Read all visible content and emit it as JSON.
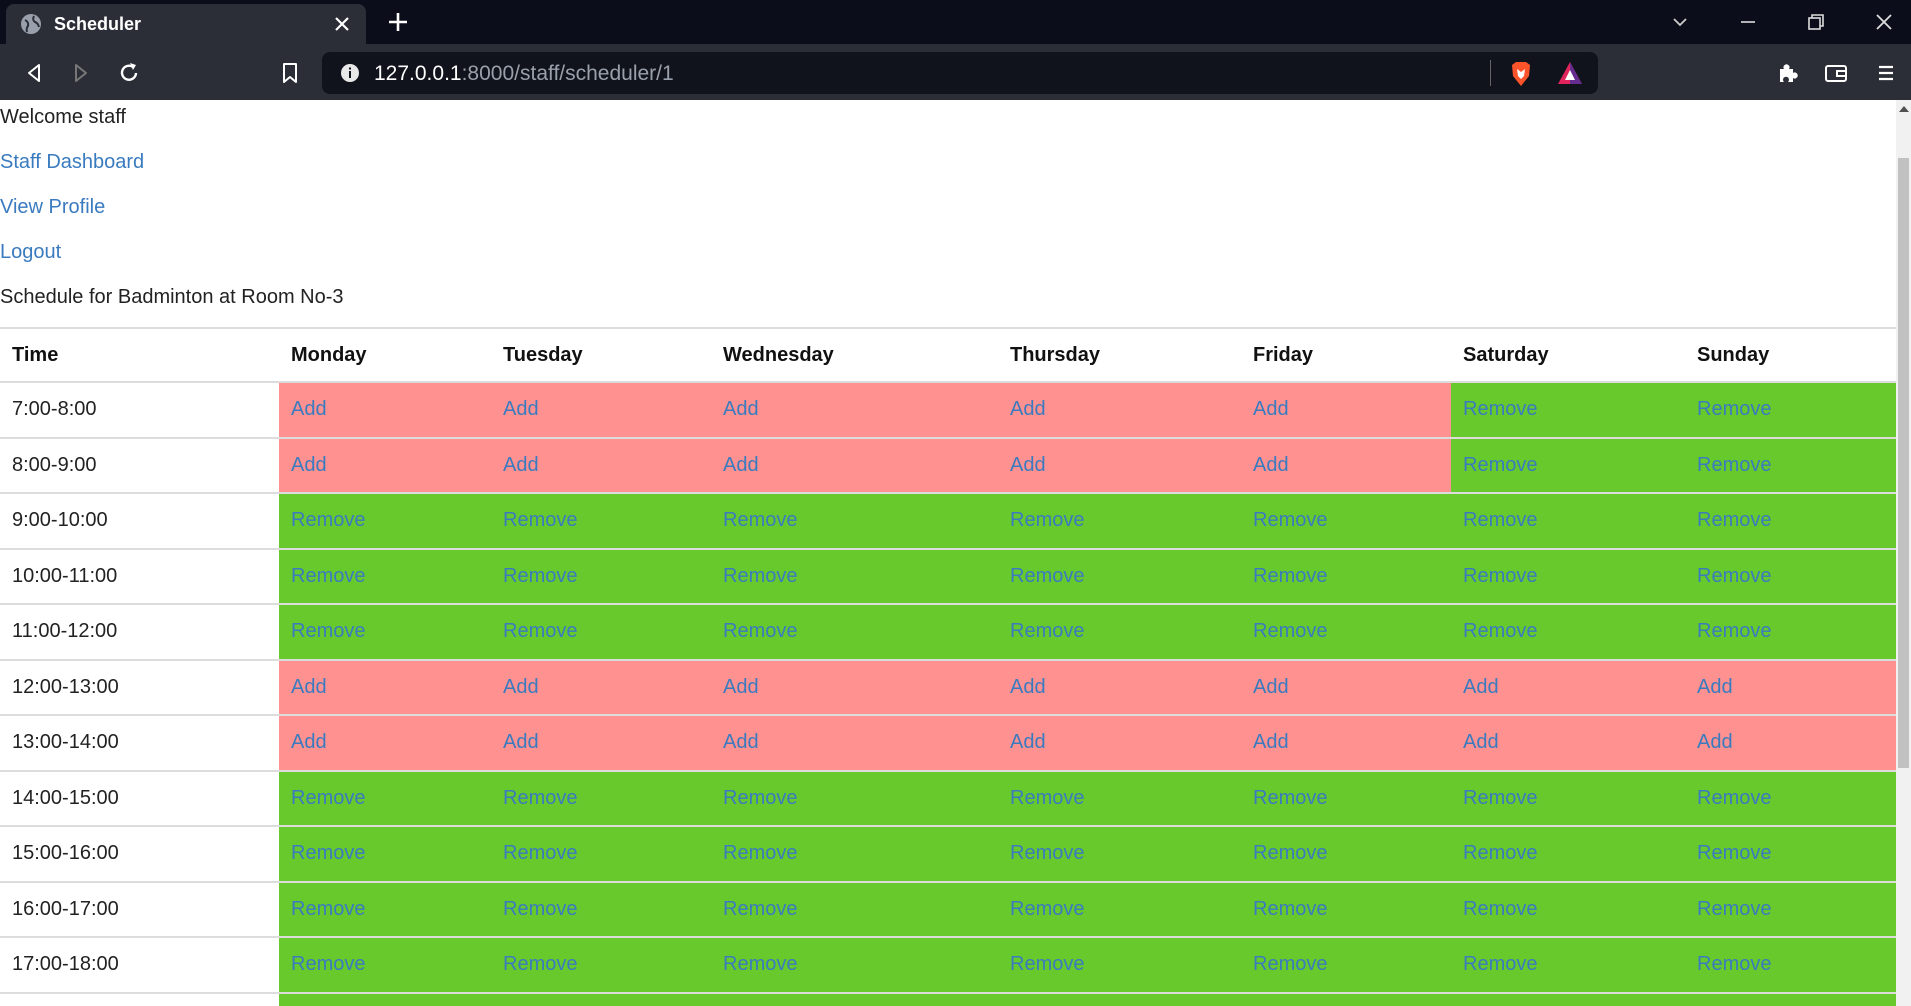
{
  "browser": {
    "tab_title": "Scheduler",
    "url_host": "127.0.0.1",
    "url_rest": ":8000/staff/scheduler/1"
  },
  "page": {
    "welcome": "Welcome staff",
    "links": {
      "dashboard": "Staff Dashboard",
      "profile": "View Profile",
      "logout": "Logout"
    },
    "schedule_title": "Schedule for Badminton at Room No-3"
  },
  "colors": {
    "add_cell": "#ff9191",
    "remove_cell": "#68c92c",
    "link": "#3a7bbf"
  },
  "schedule": {
    "headers": [
      "Time",
      "Monday",
      "Tuesday",
      "Wednesday",
      "Thursday",
      "Friday",
      "Saturday",
      "Sunday"
    ],
    "rows": [
      {
        "time": "7:00-8:00",
        "cells": [
          "Add",
          "Add",
          "Add",
          "Add",
          "Add",
          "Remove",
          "Remove"
        ]
      },
      {
        "time": "8:00-9:00",
        "cells": [
          "Add",
          "Add",
          "Add",
          "Add",
          "Add",
          "Remove",
          "Remove"
        ]
      },
      {
        "time": "9:00-10:00",
        "cells": [
          "Remove",
          "Remove",
          "Remove",
          "Remove",
          "Remove",
          "Remove",
          "Remove"
        ]
      },
      {
        "time": "10:00-11:00",
        "cells": [
          "Remove",
          "Remove",
          "Remove",
          "Remove",
          "Remove",
          "Remove",
          "Remove"
        ]
      },
      {
        "time": "11:00-12:00",
        "cells": [
          "Remove",
          "Remove",
          "Remove",
          "Remove",
          "Remove",
          "Remove",
          "Remove"
        ]
      },
      {
        "time": "12:00-13:00",
        "cells": [
          "Add",
          "Add",
          "Add",
          "Add",
          "Add",
          "Add",
          "Add"
        ]
      },
      {
        "time": "13:00-14:00",
        "cells": [
          "Add",
          "Add",
          "Add",
          "Add",
          "Add",
          "Add",
          "Add"
        ]
      },
      {
        "time": "14:00-15:00",
        "cells": [
          "Remove",
          "Remove",
          "Remove",
          "Remove",
          "Remove",
          "Remove",
          "Remove"
        ]
      },
      {
        "time": "15:00-16:00",
        "cells": [
          "Remove",
          "Remove",
          "Remove",
          "Remove",
          "Remove",
          "Remove",
          "Remove"
        ]
      },
      {
        "time": "16:00-17:00",
        "cells": [
          "Remove",
          "Remove",
          "Remove",
          "Remove",
          "Remove",
          "Remove",
          "Remove"
        ]
      },
      {
        "time": "17:00-18:00",
        "cells": [
          "Remove",
          "Remove",
          "Remove",
          "Remove",
          "Remove",
          "Remove",
          "Remove"
        ]
      },
      {
        "time": "",
        "cells": [
          "",
          "",
          "",
          "",
          "",
          "",
          ""
        ]
      }
    ]
  }
}
